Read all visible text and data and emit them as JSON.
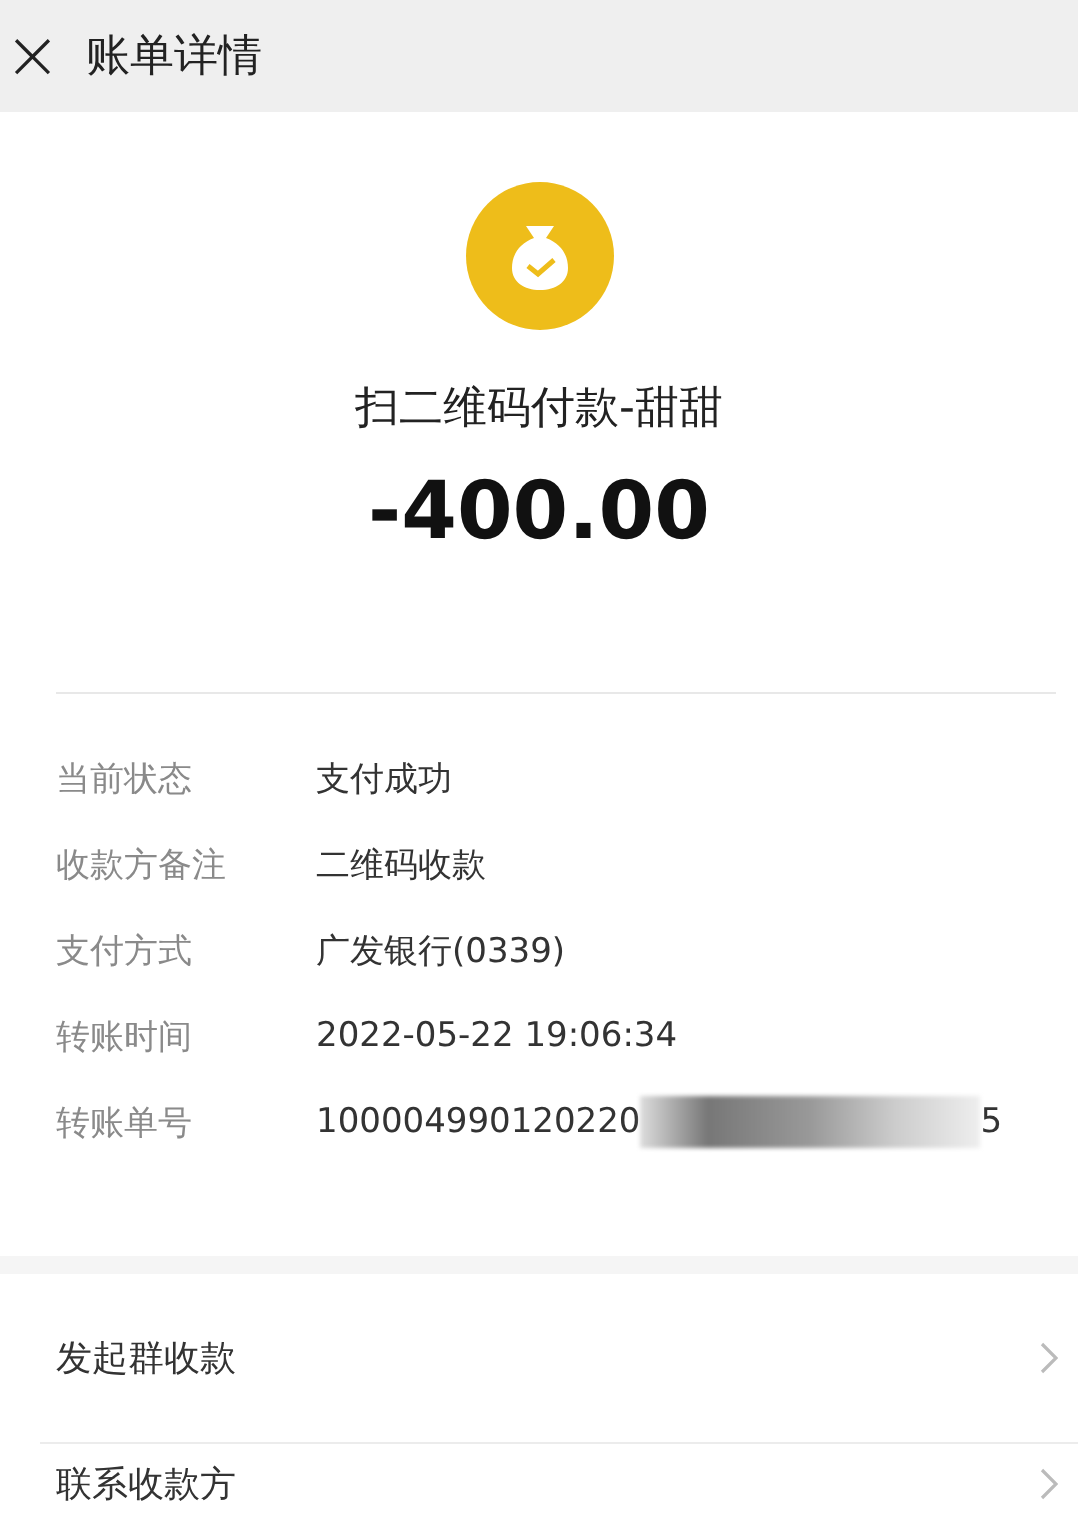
{
  "header": {
    "close_glyph": "×",
    "title": "账单详情"
  },
  "summary": {
    "title": "扫二维码付款-甜甜",
    "amount": "-400.00"
  },
  "details": [
    {
      "label": "当前状态",
      "value": "支付成功"
    },
    {
      "label": "收款方备注",
      "value": "二维码收款"
    },
    {
      "label": "支付方式",
      "value": "广发银行(0339)"
    },
    {
      "label": "转账时间",
      "value": "2022-05-22 19:06:34"
    },
    {
      "label": "转账单号",
      "value": "100004990120220",
      "redacted": true,
      "value_end": "5"
    }
  ],
  "actions": [
    {
      "label": "发起群收款"
    },
    {
      "label": "联系收款方"
    }
  ]
}
